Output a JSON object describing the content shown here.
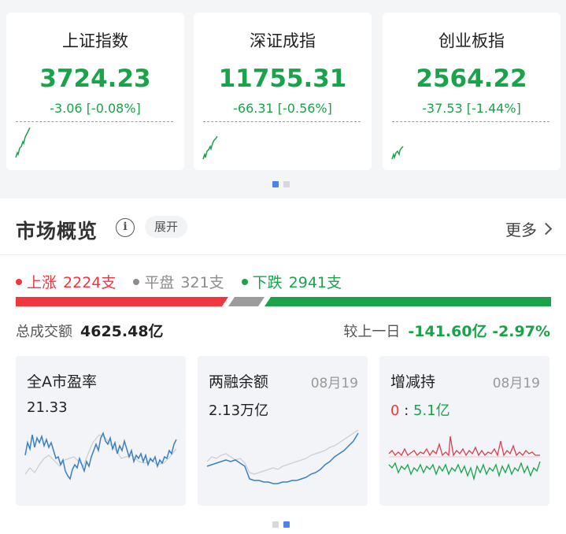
{
  "indices": [
    {
      "name": "上证指数",
      "value": "3724.23",
      "change": "-3.06 [-0.08%]"
    },
    {
      "name": "深证成指",
      "value": "11755.31",
      "change": "-66.31 [-0.56%]"
    },
    {
      "name": "创业板指",
      "value": "2564.22",
      "change": "-37.53 [-1.44%]"
    }
  ],
  "overview": {
    "title": "市场概览",
    "info_icon": "info-icon",
    "expand_label": "展开",
    "more_label": "更多"
  },
  "breadth": {
    "up_label": "上涨",
    "up_count": "2224支",
    "flat_label": "平盘",
    "flat_count": "321支",
    "down_label": "下跌",
    "down_count": "2941支"
  },
  "turnover": {
    "label": "总成交额",
    "value": "4625.48亿",
    "compare_label": "较上一日",
    "compare_value": "-141.60亿 -2.97%"
  },
  "cards": [
    {
      "title": "全A市盈率",
      "value": "21.33",
      "date": ""
    },
    {
      "title": "两融余额",
      "value": "2.13万亿",
      "date": "08月19"
    },
    {
      "title": "增减持",
      "value_red": "0",
      "value_sep": ":",
      "value_green": "5.1亿",
      "date": "08月19"
    }
  ],
  "colors": {
    "up": "#f0363f",
    "down": "#1aa34a",
    "flat": "#8c8c8c",
    "accent": "#4a86e8",
    "line_blue": "#3a7fc1"
  }
}
